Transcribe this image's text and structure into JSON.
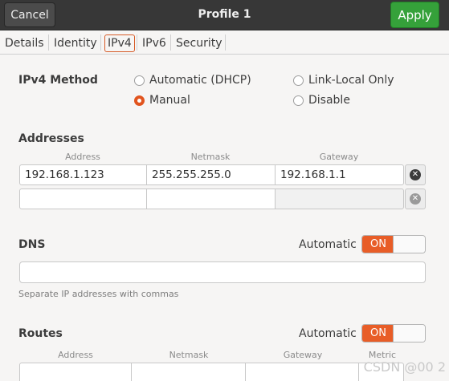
{
  "header": {
    "cancel_label": "Cancel",
    "title": "Profile 1",
    "apply_label": "Apply"
  },
  "tabs": [
    "Details",
    "Identity",
    "IPv4",
    "IPv6",
    "Security"
  ],
  "active_tab": "IPv4",
  "ipv4_method": {
    "label": "IPv4 Method",
    "options": [
      "Automatic (DHCP)",
      "Link-Local Only",
      "Manual",
      "Disable"
    ],
    "selected": "Manual"
  },
  "addresses": {
    "label": "Addresses",
    "columns": [
      "Address",
      "Netmask",
      "Gateway"
    ],
    "rows": [
      [
        "192.168.1.123",
        "255.255.255.0",
        "192.168.1.1"
      ],
      [
        "",
        "",
        ""
      ]
    ]
  },
  "dns": {
    "label": "DNS",
    "automatic_label": "Automatic",
    "switch_label": "ON",
    "value": "",
    "hint": "Separate IP addresses with commas"
  },
  "routes": {
    "label": "Routes",
    "automatic_label": "Automatic",
    "switch_label": "ON",
    "columns": [
      "Address",
      "Netmask",
      "Gateway",
      "Metric"
    ]
  },
  "watermark": "CSDN @00 2",
  "colors": {
    "accent": "#e85d27",
    "apply_green": "#35a13a",
    "header_bg": "#373737"
  }
}
